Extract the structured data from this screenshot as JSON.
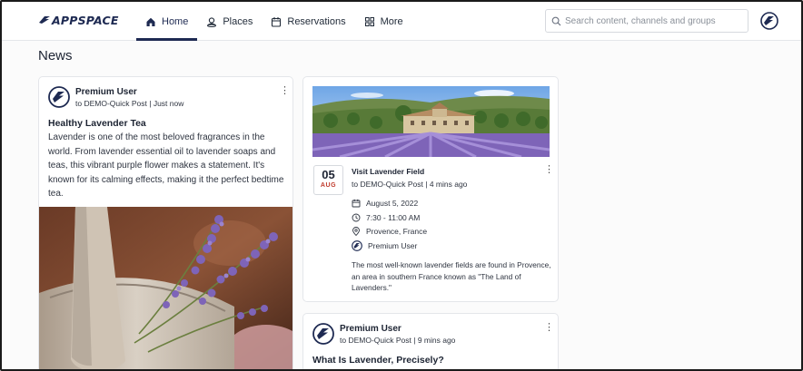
{
  "header": {
    "logo_text": "APPSPACE",
    "nav": [
      {
        "label": "Home",
        "icon": "home-icon",
        "active": true
      },
      {
        "label": "Places",
        "icon": "places-icon",
        "active": false
      },
      {
        "label": "Reservations",
        "icon": "calendar-icon",
        "active": false
      },
      {
        "label": "More",
        "icon": "grid-icon",
        "active": false
      }
    ],
    "search_placeholder": "Search content, channels and groups"
  },
  "page": {
    "title": "News"
  },
  "posts": [
    {
      "author": "Premium User",
      "channel": "to DEMO-Quick Post",
      "time": "Just now",
      "title": "Healthy Lavender Tea",
      "body": "Lavender is one of the most beloved fragrances in the world. From lavender essential oil to lavender soaps and teas, this vibrant purple flower makes a statement. It's known for its calming effects, making it the perfect bedtime tea."
    },
    {
      "type": "event",
      "day": "05",
      "month": "AUG",
      "title": "Visit Lavender Field",
      "channel": "to DEMO-Quick Post",
      "time": "4 mins ago",
      "date": "August 5, 2022",
      "time_range": "7:30 - 11:00 AM",
      "location": "Provence, France",
      "organizer": "Premium User",
      "description": "The most well-known lavender fields are found in Provence, an area in southern France known as \"The Land of Lavenders.\""
    },
    {
      "author": "Premium User",
      "channel": "to DEMO-Quick Post",
      "time": "9 mins ago",
      "title": "What Is Lavender, Precisely?"
    }
  ],
  "colors": {
    "brand": "#1e2a52",
    "month_accent": "#c0392b",
    "lavender": "#7e64b8"
  }
}
